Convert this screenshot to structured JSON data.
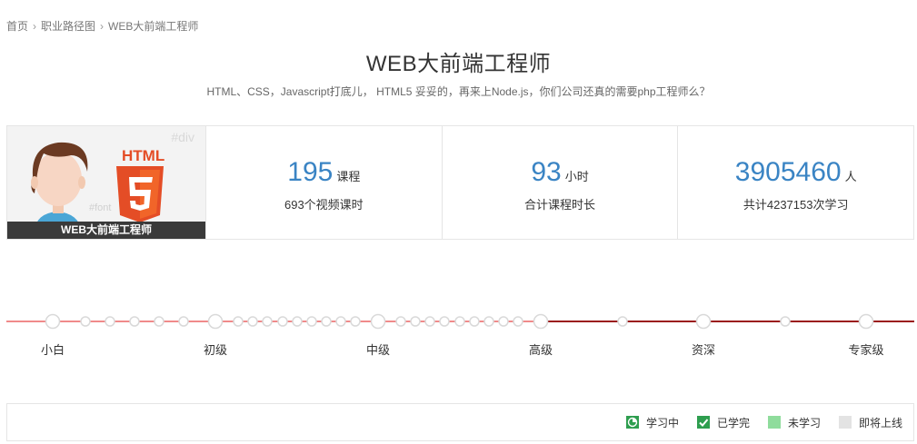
{
  "breadcrumb": {
    "home": "首页",
    "level2": "职业路径图",
    "current": "WEB大前端工程师"
  },
  "header": {
    "title": "WEB大前端工程师",
    "subtitle": "HTML、CSS，Javascript打底儿， HTML5 妥妥的，再来上Node.js，你们公司还真的需要php工程师么？"
  },
  "thumbnail": {
    "caption": "WEB大前端工程师",
    "html_badge": "HTML",
    "html_version": "5",
    "tag_div": "#div",
    "tag_font": "#font"
  },
  "stats": [
    {
      "num": "195",
      "unit": "课程",
      "desc": "693个视频课时"
    },
    {
      "num": "93",
      "unit": "小时",
      "desc": "合计课程时长"
    },
    {
      "num": "3905460",
      "unit": "人",
      "desc": "共计4237153次学习"
    }
  ],
  "timeline": {
    "stages": [
      "小白",
      "初级",
      "中级",
      "高级",
      "资深",
      "专家级"
    ],
    "colors": {
      "pending": "#f08a8a",
      "upcoming": "#9b1b1b",
      "node": "#d9d9d9"
    }
  },
  "legend": [
    {
      "label": "学习中",
      "color": "#2e9e4f",
      "icon": "pie-progress-icon"
    },
    {
      "label": "已学完",
      "color": "#2e9e4f",
      "icon": "check-icon"
    },
    {
      "label": "未学习",
      "color": "#8fdc9c",
      "icon": "square-icon"
    },
    {
      "label": "即将上线",
      "color": "#e3e3e3",
      "icon": "square-icon"
    }
  ]
}
